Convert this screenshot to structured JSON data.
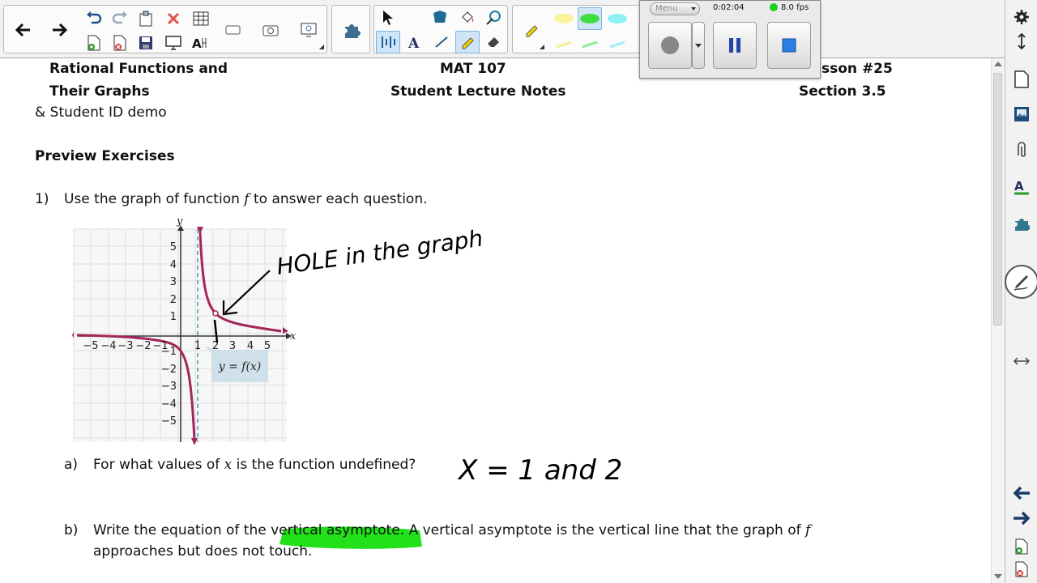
{
  "document": {
    "header_left_line1": "Rational Functions and",
    "header_left_line2": "Their Graphs",
    "header_center_line1": "MAT 107",
    "header_center_line2": "Student Lecture Notes",
    "header_right_line1": "sson #25",
    "header_right_line2": "Section 3.5",
    "subtitle": "& Student ID demo",
    "section_heading": "Preview Exercises",
    "q1_number": "1)",
    "q1_text_before": "Use the graph of function",
    "q1_func": "f",
    "q1_text_after": "to answer each question.",
    "qa_label": "a)",
    "qa_before": "For what values of",
    "qa_var": "x",
    "qa_after": "is the function undefined?",
    "qb_label": "b)",
    "qb_part1": "Write the equation of the vertical asymptote. A vertical asymptote is the vertical line that the graph of",
    "qb_func": "f",
    "qb_line2": "approaches but does not touch."
  },
  "graph": {
    "y_axis_label": "y",
    "x_axis_label": "x",
    "y_ticks": [
      "5",
      "4",
      "3",
      "2",
      "1",
      "−1",
      "−2",
      "−3",
      "−4",
      "−5"
    ],
    "x_ticks": [
      "−5",
      "−4",
      "−3",
      "−2",
      "−1",
      "1",
      "2",
      "3",
      "4",
      "5"
    ],
    "func_label": "y = f(x)"
  },
  "annotations": {
    "hole_note": "HOLE in the graph",
    "answer_a": "X = 1 and 2"
  },
  "recorder": {
    "menu_label": "Menu",
    "elapsed": "0:02:04",
    "fps": "8.0 fps",
    "status_color": "#1fd11f"
  },
  "colors": {
    "highlight": "#22e01a",
    "curve": "#a3265a",
    "asymptote": "#2a9aa0",
    "selection": "#cfe4f7"
  }
}
